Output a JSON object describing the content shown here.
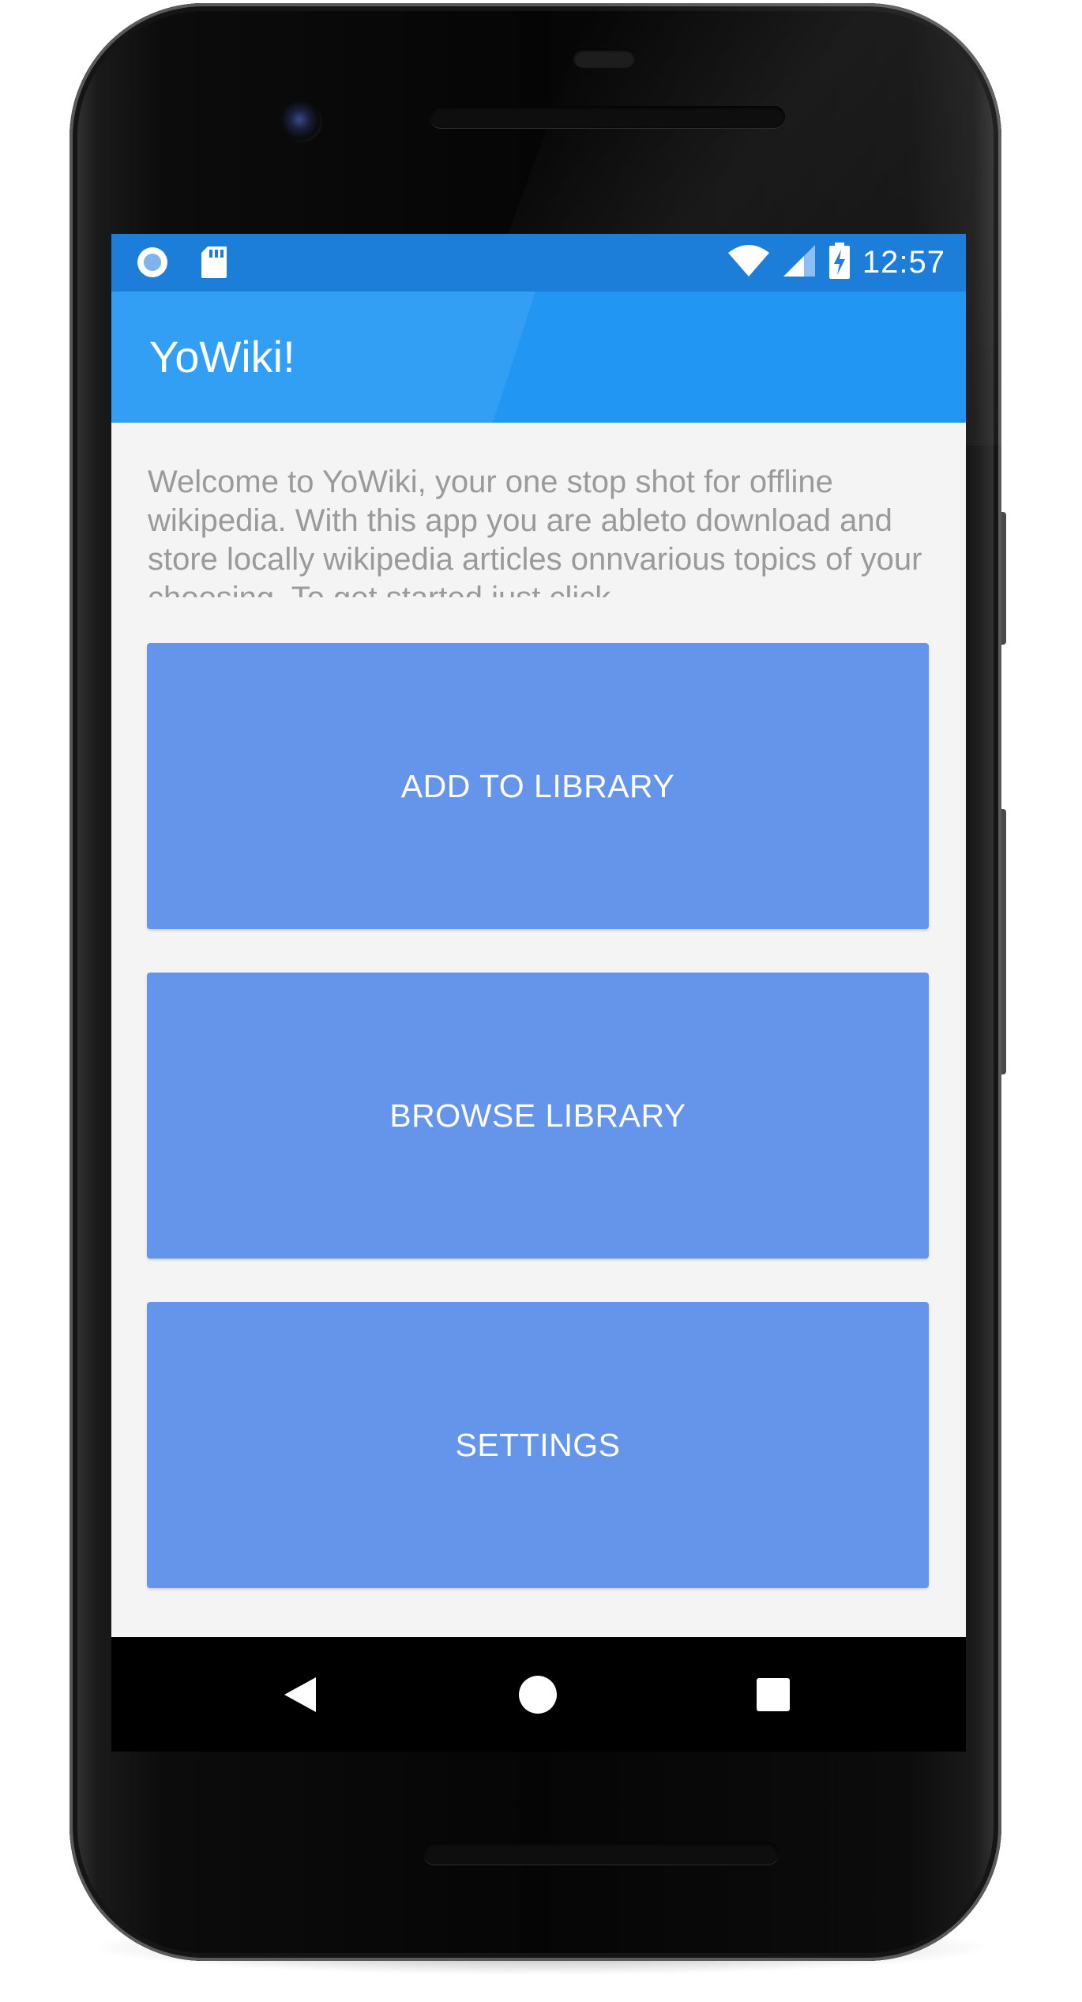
{
  "status_bar": {
    "left_icons": [
      "record-icon",
      "sd-card-icon"
    ],
    "right_icons": [
      "wifi-icon",
      "cell-signal-icon",
      "battery-charging-icon"
    ],
    "time": "12:57"
  },
  "app_bar": {
    "title": "YoWiki!",
    "color": "#2196f3"
  },
  "main": {
    "welcome_text": "Welcome to YoWiki, your one stop shot for offline wikipedia. With this app you are ableto download and store locally wikipedia articles onnvarious topics of your choosing. To get started just click",
    "buttons": [
      {
        "label": "ADD TO LIBRARY"
      },
      {
        "label": "BROWSE LIBRARY"
      },
      {
        "label": "SETTINGS"
      }
    ],
    "button_color": "#6595ea"
  },
  "nav_bar": {
    "icons": [
      "back-icon",
      "home-icon",
      "recents-icon"
    ]
  }
}
